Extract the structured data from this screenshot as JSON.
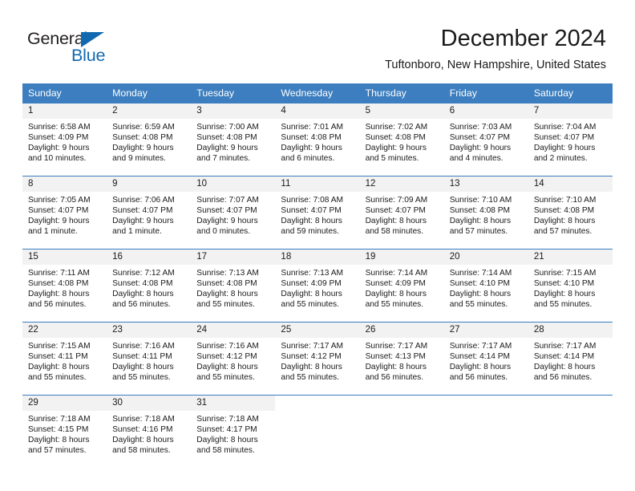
{
  "brand": {
    "name_top": "General",
    "name_bottom": "Blue",
    "accent_color": "#1269b0"
  },
  "header": {
    "title": "December 2024",
    "location": "Tuftonboro, New Hampshire, United States"
  },
  "calendar": {
    "header_bg": "#3c7ebf",
    "daynum_bg": "#f2f2f2",
    "weekdays": [
      "Sunday",
      "Monday",
      "Tuesday",
      "Wednesday",
      "Thursday",
      "Friday",
      "Saturday"
    ],
    "weeks": [
      [
        {
          "day": "1",
          "sunrise": "Sunrise: 6:58 AM",
          "sunset": "Sunset: 4:09 PM",
          "daylight_1": "Daylight: 9 hours",
          "daylight_2": "and 10 minutes."
        },
        {
          "day": "2",
          "sunrise": "Sunrise: 6:59 AM",
          "sunset": "Sunset: 4:08 PM",
          "daylight_1": "Daylight: 9 hours",
          "daylight_2": "and 9 minutes."
        },
        {
          "day": "3",
          "sunrise": "Sunrise: 7:00 AM",
          "sunset": "Sunset: 4:08 PM",
          "daylight_1": "Daylight: 9 hours",
          "daylight_2": "and 7 minutes."
        },
        {
          "day": "4",
          "sunrise": "Sunrise: 7:01 AM",
          "sunset": "Sunset: 4:08 PM",
          "daylight_1": "Daylight: 9 hours",
          "daylight_2": "and 6 minutes."
        },
        {
          "day": "5",
          "sunrise": "Sunrise: 7:02 AM",
          "sunset": "Sunset: 4:08 PM",
          "daylight_1": "Daylight: 9 hours",
          "daylight_2": "and 5 minutes."
        },
        {
          "day": "6",
          "sunrise": "Sunrise: 7:03 AM",
          "sunset": "Sunset: 4:07 PM",
          "daylight_1": "Daylight: 9 hours",
          "daylight_2": "and 4 minutes."
        },
        {
          "day": "7",
          "sunrise": "Sunrise: 7:04 AM",
          "sunset": "Sunset: 4:07 PM",
          "daylight_1": "Daylight: 9 hours",
          "daylight_2": "and 2 minutes."
        }
      ],
      [
        {
          "day": "8",
          "sunrise": "Sunrise: 7:05 AM",
          "sunset": "Sunset: 4:07 PM",
          "daylight_1": "Daylight: 9 hours",
          "daylight_2": "and 1 minute."
        },
        {
          "day": "9",
          "sunrise": "Sunrise: 7:06 AM",
          "sunset": "Sunset: 4:07 PM",
          "daylight_1": "Daylight: 9 hours",
          "daylight_2": "and 1 minute."
        },
        {
          "day": "10",
          "sunrise": "Sunrise: 7:07 AM",
          "sunset": "Sunset: 4:07 PM",
          "daylight_1": "Daylight: 9 hours",
          "daylight_2": "and 0 minutes."
        },
        {
          "day": "11",
          "sunrise": "Sunrise: 7:08 AM",
          "sunset": "Sunset: 4:07 PM",
          "daylight_1": "Daylight: 8 hours",
          "daylight_2": "and 59 minutes."
        },
        {
          "day": "12",
          "sunrise": "Sunrise: 7:09 AM",
          "sunset": "Sunset: 4:07 PM",
          "daylight_1": "Daylight: 8 hours",
          "daylight_2": "and 58 minutes."
        },
        {
          "day": "13",
          "sunrise": "Sunrise: 7:10 AM",
          "sunset": "Sunset: 4:08 PM",
          "daylight_1": "Daylight: 8 hours",
          "daylight_2": "and 57 minutes."
        },
        {
          "day": "14",
          "sunrise": "Sunrise: 7:10 AM",
          "sunset": "Sunset: 4:08 PM",
          "daylight_1": "Daylight: 8 hours",
          "daylight_2": "and 57 minutes."
        }
      ],
      [
        {
          "day": "15",
          "sunrise": "Sunrise: 7:11 AM",
          "sunset": "Sunset: 4:08 PM",
          "daylight_1": "Daylight: 8 hours",
          "daylight_2": "and 56 minutes."
        },
        {
          "day": "16",
          "sunrise": "Sunrise: 7:12 AM",
          "sunset": "Sunset: 4:08 PM",
          "daylight_1": "Daylight: 8 hours",
          "daylight_2": "and 56 minutes."
        },
        {
          "day": "17",
          "sunrise": "Sunrise: 7:13 AM",
          "sunset": "Sunset: 4:08 PM",
          "daylight_1": "Daylight: 8 hours",
          "daylight_2": "and 55 minutes."
        },
        {
          "day": "18",
          "sunrise": "Sunrise: 7:13 AM",
          "sunset": "Sunset: 4:09 PM",
          "daylight_1": "Daylight: 8 hours",
          "daylight_2": "and 55 minutes."
        },
        {
          "day": "19",
          "sunrise": "Sunrise: 7:14 AM",
          "sunset": "Sunset: 4:09 PM",
          "daylight_1": "Daylight: 8 hours",
          "daylight_2": "and 55 minutes."
        },
        {
          "day": "20",
          "sunrise": "Sunrise: 7:14 AM",
          "sunset": "Sunset: 4:10 PM",
          "daylight_1": "Daylight: 8 hours",
          "daylight_2": "and 55 minutes."
        },
        {
          "day": "21",
          "sunrise": "Sunrise: 7:15 AM",
          "sunset": "Sunset: 4:10 PM",
          "daylight_1": "Daylight: 8 hours",
          "daylight_2": "and 55 minutes."
        }
      ],
      [
        {
          "day": "22",
          "sunrise": "Sunrise: 7:15 AM",
          "sunset": "Sunset: 4:11 PM",
          "daylight_1": "Daylight: 8 hours",
          "daylight_2": "and 55 minutes."
        },
        {
          "day": "23",
          "sunrise": "Sunrise: 7:16 AM",
          "sunset": "Sunset: 4:11 PM",
          "daylight_1": "Daylight: 8 hours",
          "daylight_2": "and 55 minutes."
        },
        {
          "day": "24",
          "sunrise": "Sunrise: 7:16 AM",
          "sunset": "Sunset: 4:12 PM",
          "daylight_1": "Daylight: 8 hours",
          "daylight_2": "and 55 minutes."
        },
        {
          "day": "25",
          "sunrise": "Sunrise: 7:17 AM",
          "sunset": "Sunset: 4:12 PM",
          "daylight_1": "Daylight: 8 hours",
          "daylight_2": "and 55 minutes."
        },
        {
          "day": "26",
          "sunrise": "Sunrise: 7:17 AM",
          "sunset": "Sunset: 4:13 PM",
          "daylight_1": "Daylight: 8 hours",
          "daylight_2": "and 56 minutes."
        },
        {
          "day": "27",
          "sunrise": "Sunrise: 7:17 AM",
          "sunset": "Sunset: 4:14 PM",
          "daylight_1": "Daylight: 8 hours",
          "daylight_2": "and 56 minutes."
        },
        {
          "day": "28",
          "sunrise": "Sunrise: 7:17 AM",
          "sunset": "Sunset: 4:14 PM",
          "daylight_1": "Daylight: 8 hours",
          "daylight_2": "and 56 minutes."
        }
      ],
      [
        {
          "day": "29",
          "sunrise": "Sunrise: 7:18 AM",
          "sunset": "Sunset: 4:15 PM",
          "daylight_1": "Daylight: 8 hours",
          "daylight_2": "and 57 minutes."
        },
        {
          "day": "30",
          "sunrise": "Sunrise: 7:18 AM",
          "sunset": "Sunset: 4:16 PM",
          "daylight_1": "Daylight: 8 hours",
          "daylight_2": "and 58 minutes."
        },
        {
          "day": "31",
          "sunrise": "Sunrise: 7:18 AM",
          "sunset": "Sunset: 4:17 PM",
          "daylight_1": "Daylight: 8 hours",
          "daylight_2": "and 58 minutes."
        },
        null,
        null,
        null,
        null
      ]
    ]
  }
}
